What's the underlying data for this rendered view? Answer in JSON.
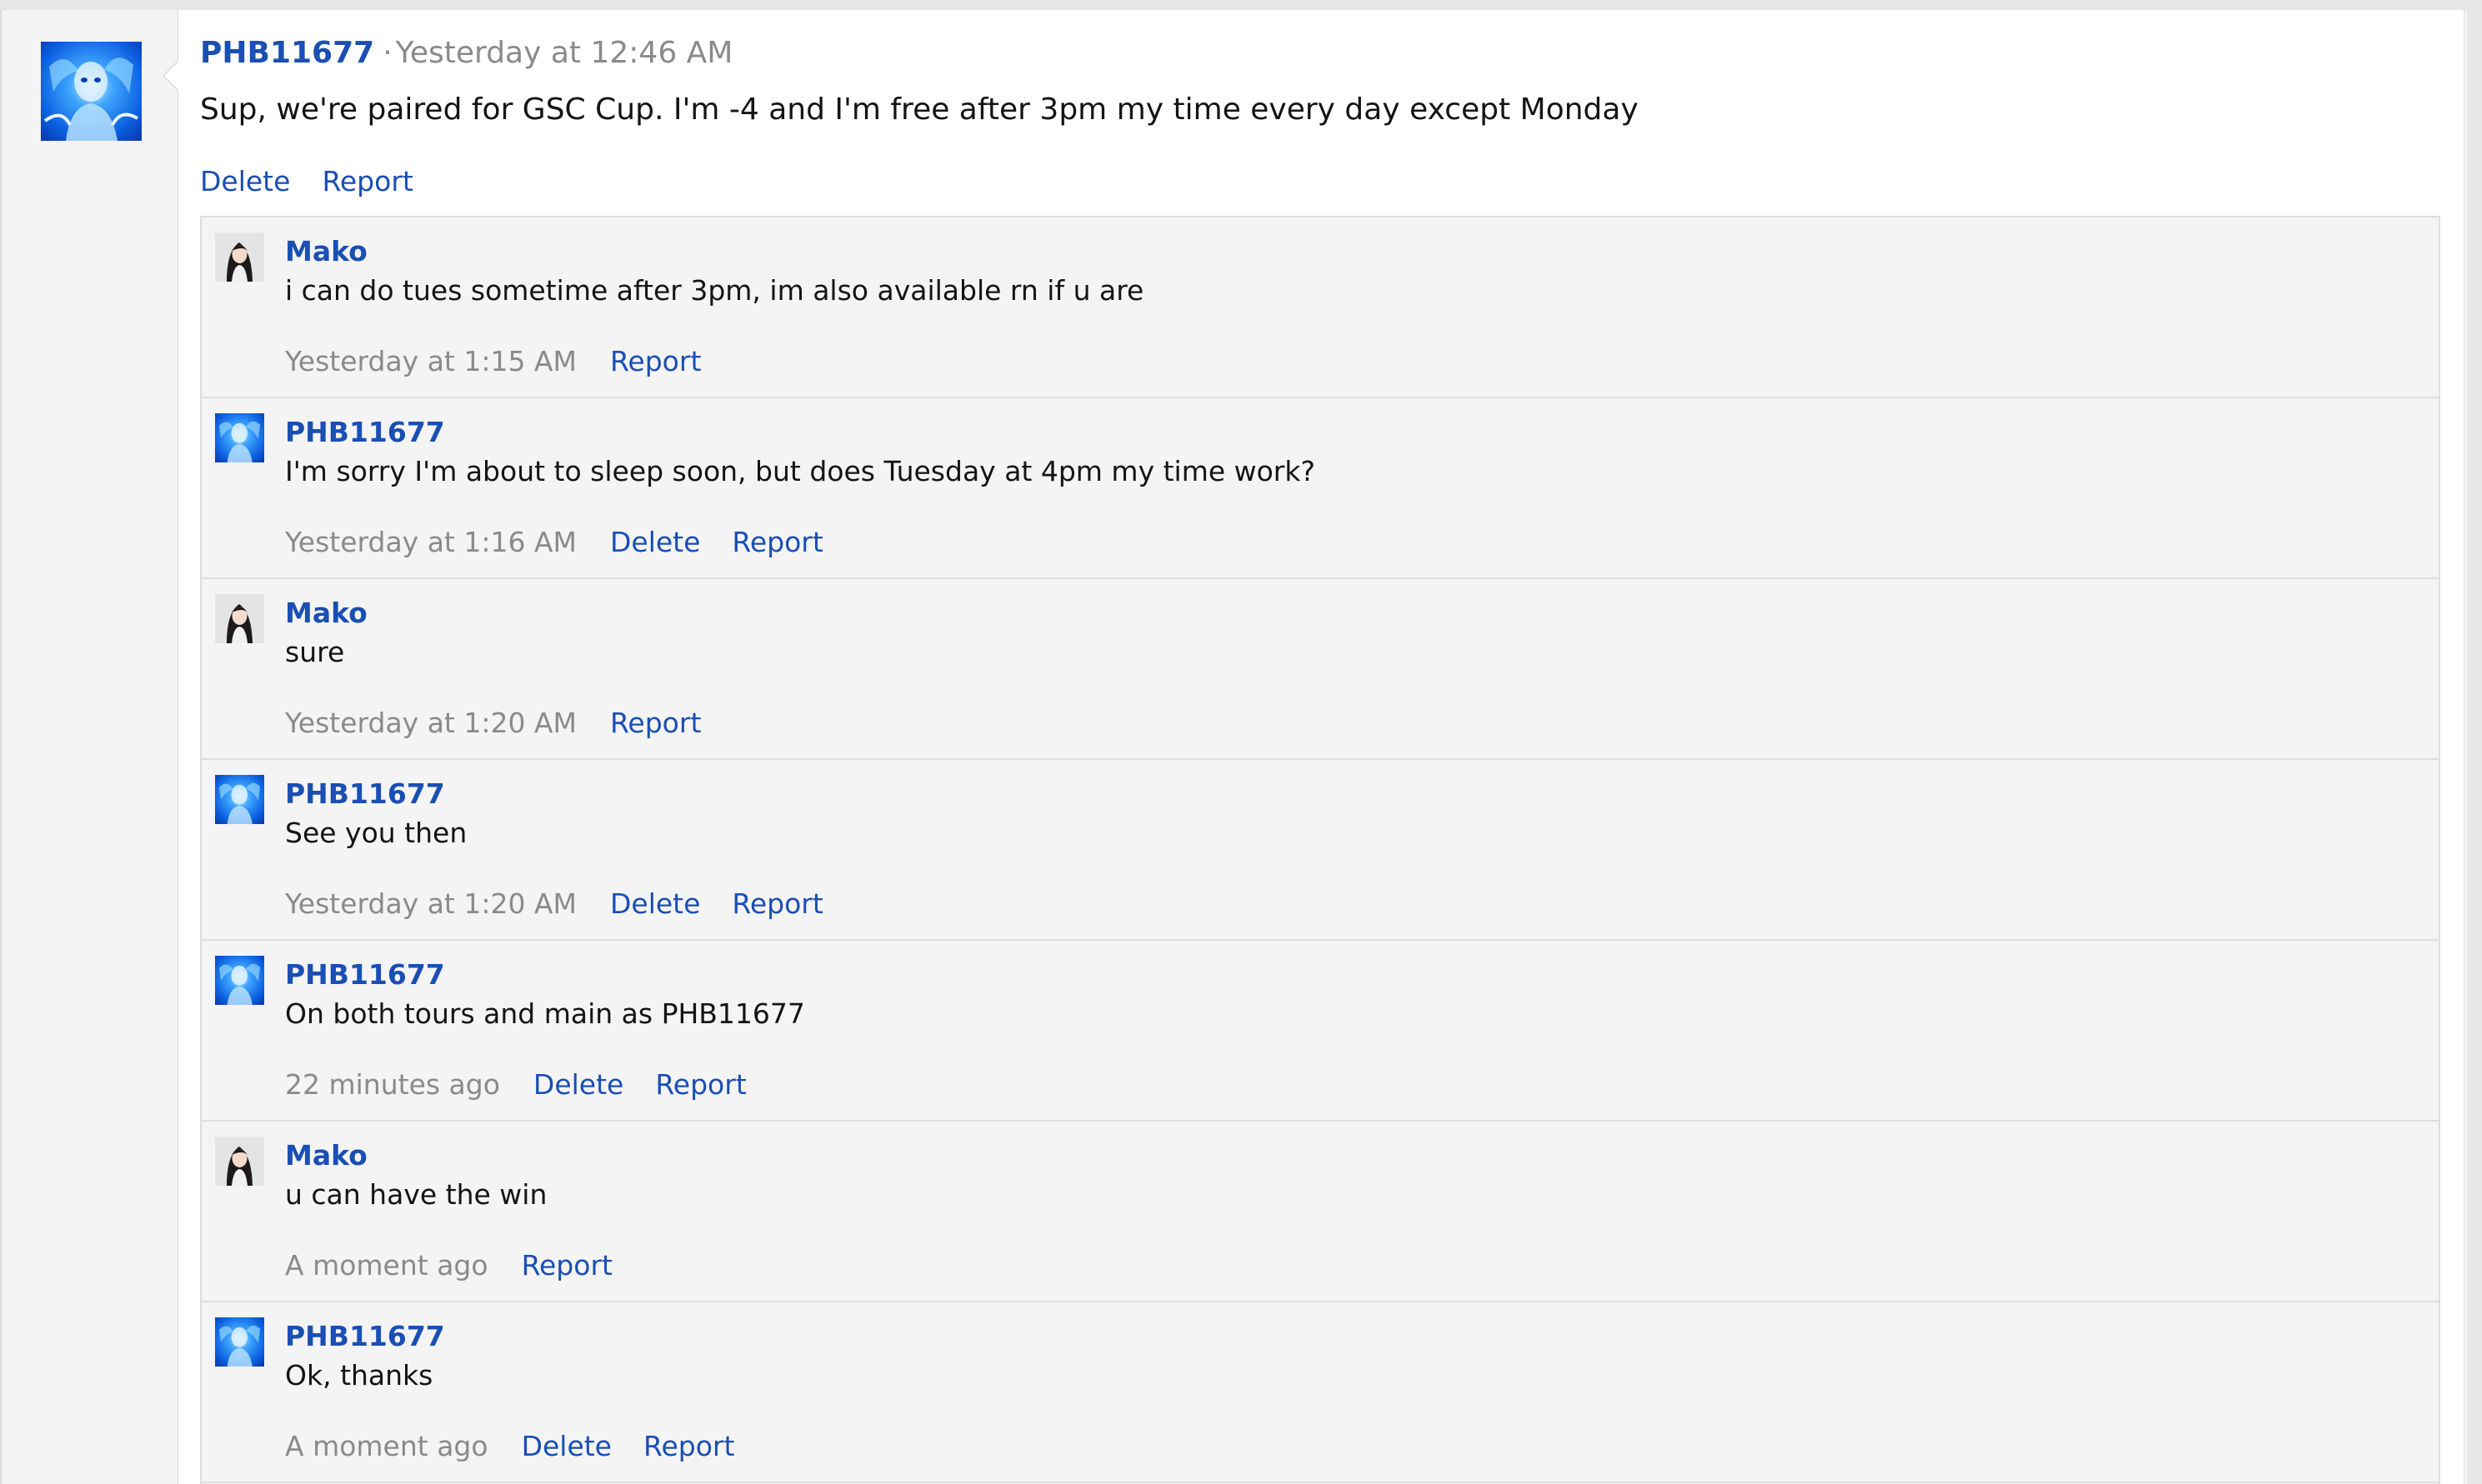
{
  "post": {
    "author": "PHB11677",
    "separator": "·",
    "time": "Yesterday at 12:46 AM",
    "text": "Sup, we're paired for GSC Cup. I'm -4 and I'm free after 3pm my time every day except Monday",
    "delete_label": "Delete",
    "report_label": "Report",
    "avatar_icon": "blue-spirit-avatar-icon"
  },
  "replies": [
    {
      "author": "Mako",
      "text": "i can do tues sometime after 3pm, im also available rn if u are",
      "time": "Yesterday at 1:15 AM",
      "report_label": "Report",
      "avatar_icon": "girl-avatar-icon"
    },
    {
      "author": "PHB11677",
      "text": "I'm sorry I'm about to sleep soon, but does Tuesday at 4pm my time work?",
      "time": "Yesterday at 1:16 AM",
      "delete_label": "Delete",
      "report_label": "Report",
      "avatar_icon": "blue-spirit-avatar-icon"
    },
    {
      "author": "Mako",
      "text": "sure",
      "time": "Yesterday at 1:20 AM",
      "report_label": "Report",
      "avatar_icon": "girl-avatar-icon"
    },
    {
      "author": "PHB11677",
      "text": "See you then",
      "time": "Yesterday at 1:20 AM",
      "delete_label": "Delete",
      "report_label": "Report",
      "avatar_icon": "blue-spirit-avatar-icon"
    },
    {
      "author": "PHB11677",
      "text": "On both tours and main as PHB11677",
      "time": "22 minutes ago",
      "delete_label": "Delete",
      "report_label": "Report",
      "avatar_icon": "blue-spirit-avatar-icon"
    },
    {
      "author": "Mako",
      "text": "u can have the win",
      "time": "A moment ago",
      "report_label": "Report",
      "avatar_icon": "girl-avatar-icon"
    },
    {
      "author": "PHB11677",
      "text": "Ok, thanks",
      "time": "A moment ago",
      "delete_label": "Delete",
      "report_label": "Report",
      "avatar_icon": "blue-spirit-avatar-icon"
    }
  ],
  "colors": {
    "link": "#1a4fb3",
    "muted": "#8a8a8a",
    "text": "#141414",
    "panel": "#f4f4f4",
    "border": "#dedede"
  }
}
